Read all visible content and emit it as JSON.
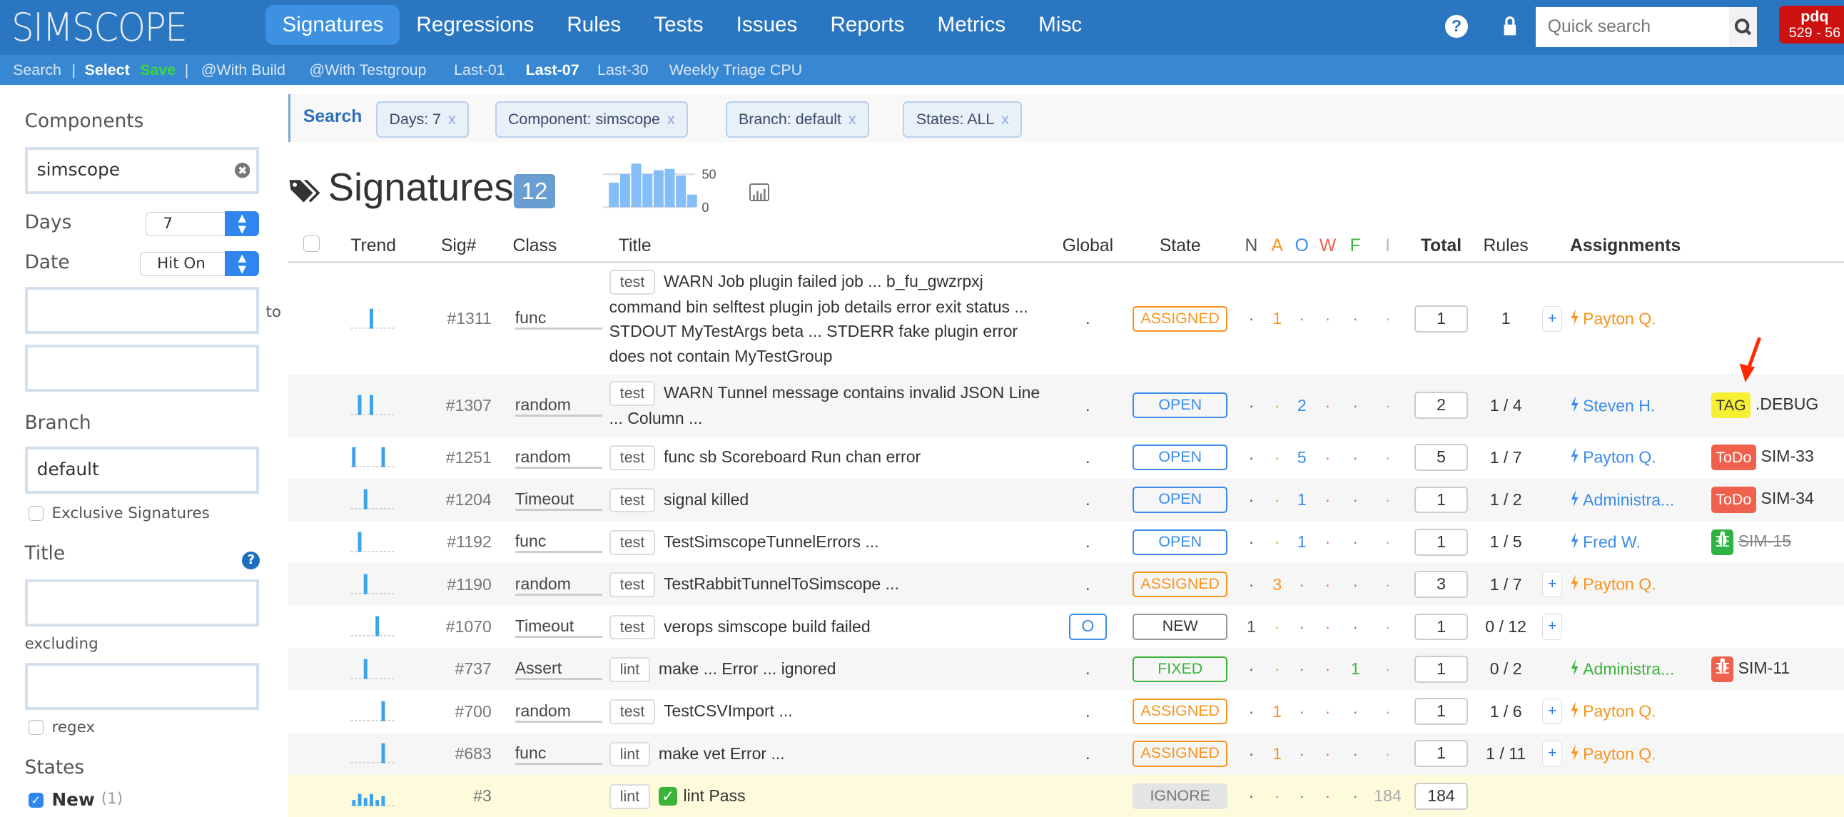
{
  "header": {
    "logo": "SIMSCOPE",
    "nav": [
      "Signatures",
      "Regressions",
      "Rules",
      "Tests",
      "Issues",
      "Reports",
      "Metrics",
      "Misc"
    ],
    "active_nav": "Signatures",
    "search_placeholder": "Quick search",
    "user": {
      "name": "pdq",
      "range": "529 - 56"
    },
    "brand_color": "#2b76c0"
  },
  "subnav": {
    "search": "Search",
    "sep": "|",
    "select": "Select",
    "save": "Save",
    "links": [
      "@With Build",
      "@With Testgroup",
      "Last-01",
      "Last-07",
      "Last-30",
      "Weekly Triage CPU"
    ],
    "active_link": "Last-07"
  },
  "sidebar": {
    "components_label": "Components",
    "components_value": "simscope",
    "days_label": "Days",
    "days_value": "7",
    "date_label": "Date",
    "date_value": "Hit On",
    "to_label": "to",
    "branch_label": "Branch",
    "branch_value": "default",
    "exclusive_label": "Exclusive Signatures",
    "title_label": "Title",
    "excluding_label": "excluding",
    "regex_label": "regex",
    "states_label": "States",
    "state_new": "New",
    "state_new_count": "(1)"
  },
  "search": {
    "label": "Search",
    "chips": [
      "Days:  7",
      "Component:  simscope",
      "Branch:  default",
      "States:  ALL"
    ],
    "remove": "x"
  },
  "page": {
    "title": "Signatures",
    "count": "12"
  },
  "chart_data": {
    "type": "bar",
    "values": [
      37,
      50,
      66,
      50,
      56,
      58,
      48,
      19
    ],
    "yticks": [
      "50",
      "0"
    ],
    "ylim": [
      0,
      50
    ],
    "color": "#84bdf7"
  },
  "table": {
    "headers": {
      "trend": "Trend",
      "sig": "Sig#",
      "class": "Class",
      "title": "Title",
      "global": "Global",
      "state": "State",
      "n": "N",
      "a": "A",
      "o": "O",
      "w": "W",
      "f": "F",
      "i": "I",
      "total": "Total",
      "rules": "Rules",
      "assignments": "Assignments"
    },
    "count_colors": {
      "n": "#555555",
      "a": "#f7941d",
      "o": "#3b8beb",
      "w": "#f0614d",
      "f": "#3bb33b",
      "i": "#aaaaaa"
    },
    "empty": "·",
    "rows": [
      {
        "trend": [
          0,
          0,
          0,
          1,
          0,
          0,
          0
        ],
        "sig": "#1311",
        "class": "func",
        "tag": "test",
        "title": "WARN Job plugin failed job ... b_fu_gwzrpxj command bin selftest plugin job details error exit status ... STDOUT MyTestArgs beta ... STDERR fake plugin error does not contain MyTestGroup",
        "global": ".",
        "state": "ASSIGNED",
        "counts": [
          null,
          1,
          null,
          null,
          null,
          null
        ],
        "total": "1",
        "rules": "1",
        "plus": true,
        "assignee": "Payton Q.",
        "extra": null
      },
      {
        "trend": [
          0,
          1,
          0,
          1,
          0,
          0,
          0
        ],
        "sig": "#1307",
        "class": "random",
        "tag": "test",
        "title": "WARN Tunnel message contains invalid JSON Line ... Column ...",
        "global": ".",
        "state": "OPEN",
        "counts": [
          null,
          null,
          2,
          null,
          null,
          null
        ],
        "total": "2",
        "rules": "1 / 4",
        "plus": false,
        "assignee": "Steven H.",
        "extra": {
          "label": "TAG",
          "kind": "tag",
          "text": ".DEBUG"
        }
      },
      {
        "trend": [
          1,
          0,
          0,
          0,
          0,
          1,
          0
        ],
        "sig": "#1251",
        "class": "random",
        "tag": "test",
        "title": "func sb Scoreboard Run chan error",
        "global": ".",
        "state": "OPEN",
        "counts": [
          null,
          null,
          5,
          null,
          null,
          null
        ],
        "total": "5",
        "rules": "1 / 7",
        "plus": false,
        "assignee": "Payton Q.",
        "extra": {
          "label": "ToDo",
          "kind": "todo",
          "text": "SIM-33"
        }
      },
      {
        "trend": [
          0,
          0,
          1,
          0,
          0,
          0,
          0
        ],
        "sig": "#1204",
        "class": "Timeout",
        "tag": "test",
        "title": "signal killed",
        "global": ".",
        "state": "OPEN",
        "counts": [
          null,
          null,
          1,
          null,
          null,
          null
        ],
        "total": "1",
        "rules": "1 / 2",
        "plus": false,
        "assignee": "Administra...",
        "extra": {
          "label": "ToDo",
          "kind": "todo",
          "text": "SIM-34"
        }
      },
      {
        "trend": [
          0,
          1,
          0,
          0,
          0,
          0,
          0
        ],
        "sig": "#1192",
        "class": "func",
        "tag": "test",
        "title": "TestSimscopeTunnelErrors ...",
        "global": ".",
        "state": "OPEN",
        "counts": [
          null,
          null,
          1,
          null,
          null,
          null
        ],
        "total": "1",
        "rules": "1 / 5",
        "plus": false,
        "assignee": "Fred W.",
        "extra": {
          "label": "bug",
          "kind": "bug-closed",
          "text": "SIM-15"
        }
      },
      {
        "trend": [
          0,
          0,
          1,
          0,
          0,
          0,
          0
        ],
        "sig": "#1190",
        "class": "random",
        "tag": "test",
        "title": "TestRabbitTunnelToSimscope ...",
        "global": ".",
        "state": "ASSIGNED",
        "counts": [
          null,
          3,
          null,
          null,
          null,
          null
        ],
        "total": "3",
        "rules": "1 / 7",
        "plus": true,
        "assignee": "Payton Q.",
        "extra": null
      },
      {
        "trend": [
          0,
          0,
          0,
          0,
          1,
          0,
          0
        ],
        "sig": "#1070",
        "class": "Timeout",
        "tag": "test",
        "title": "verops simscope build failed",
        "global": "O",
        "state": "NEW",
        "counts": [
          1,
          null,
          null,
          null,
          null,
          null
        ],
        "total": "1",
        "rules": "0 / 12",
        "plus": true,
        "assignee": "",
        "extra": null
      },
      {
        "trend": [
          0,
          0,
          1,
          0,
          0,
          0,
          0
        ],
        "sig": "#737",
        "class": "Assert",
        "tag": "lint",
        "title": "make ... Error ... ignored",
        "global": ".",
        "state": "FIXED",
        "counts": [
          null,
          null,
          null,
          null,
          1,
          null
        ],
        "total": "1",
        "rules": "0 / 2",
        "plus": false,
        "assignee": "Administra...",
        "extra": {
          "label": "bug",
          "kind": "bug-open",
          "text": "SIM-11"
        }
      },
      {
        "trend": [
          0,
          0,
          0,
          0,
          0,
          1,
          0
        ],
        "sig": "#700",
        "class": "random",
        "tag": "test",
        "title": "TestCSVImport ...",
        "global": ".",
        "state": "ASSIGNED",
        "counts": [
          null,
          1,
          null,
          null,
          null,
          null
        ],
        "total": "1",
        "rules": "1 / 6",
        "plus": true,
        "assignee": "Payton Q.",
        "extra": null
      },
      {
        "trend": [
          0,
          0,
          0,
          0,
          0,
          1,
          0
        ],
        "sig": "#683",
        "class": "func",
        "tag": "lint",
        "title": "make vet Error ...",
        "global": ".",
        "state": "ASSIGNED",
        "counts": [
          null,
          1,
          null,
          null,
          null,
          null
        ],
        "total": "1",
        "rules": "1 / 11",
        "plus": true,
        "assignee": "Payton Q.",
        "extra": null
      },
      {
        "trend": [
          0.3,
          0.6,
          0.4,
          0.6,
          0.3,
          0.5,
          0
        ],
        "sig": "#3",
        "class": "",
        "tag": "lint",
        "title": "lint Pass",
        "pass": true,
        "global": "",
        "state": "IGNORE",
        "counts": [
          null,
          null,
          null,
          null,
          null,
          184
        ],
        "total": "184",
        "rules": "",
        "plus": false,
        "assignee": "",
        "extra": null
      }
    ]
  },
  "state_colors": {
    "ASSIGNED": "#f7941d",
    "OPEN": "#3b8beb",
    "NEW": "#999999",
    "FIXED": "#3bb33b",
    "IGNORE": "#999999"
  },
  "label_colors": {
    "tag": "#f5f032",
    "todo": "#f0614d",
    "bug-closed": "#2fb344",
    "bug-open": "#f0614d"
  }
}
